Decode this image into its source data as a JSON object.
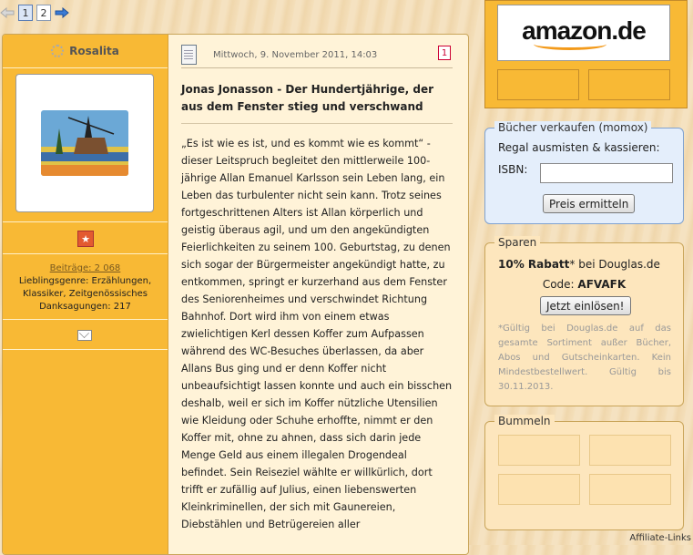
{
  "pager": {
    "pages": [
      "1",
      "2"
    ],
    "current": "1"
  },
  "author": {
    "name": "Rosalita",
    "posts_label": "Beiträge: 2 068",
    "genres": "Lieblingsgenre: Erzählungen, Klassiker, Zeitgenössisches",
    "thanks": "Danksagungen: 217"
  },
  "post": {
    "date": "Mittwoch, 9. November 2011, 14:03",
    "number": "1",
    "title": "Jonas Jonasson - Der Hundertjährige, der aus dem Fenster stieg und verschwand",
    "body": "„Es ist wie es ist, und es kommt wie es kommt“ - dieser Leitspruch begleitet den mittlerweile 100-jährige Allan Emanuel Karlsson sein Leben lang, ein Leben das turbulenter nicht sein kann. Trotz seines fortgeschrittenen Alters ist Allan körperlich und geistig überaus agil, und um den angekündigten Feierlichkeiten zu seinem 100. Geburtstag, zu denen sich sogar der Bürgermeister angekündigt hatte, zu entkommen, springt er kurzerhand aus dem Fenster des Seniorenheimes und verschwindet Richtung Bahnhof. Dort wird ihm von einem etwas zwielichtigen Kerl dessen Koffer zum Aufpassen während des WC-Besuches überlassen, da aber Allans Bus ging und er denn Koffer nicht unbeaufsichtigt lassen konnte und auch ein bisschen deshalb, weil er sich im Koffer nützliche Utensilien wie Kleidung oder Schuhe erhoffte, nimmt er den Koffer mit, ohne zu ahnen, dass sich darin jede Menge Geld aus einem illegalen Drogendeal befindet. Sein Reiseziel wählte er willkürlich, dort trifft er zufällig auf Julius, einen liebenswerten Kleinkriminellen, der sich mit Gaunereien, Diebstählen und Betrügereien aller"
  },
  "amazon": {
    "logo_text": "amazon.de"
  },
  "momox": {
    "legend": "Bücher verkaufen (momox)",
    "text": "Regal ausmisten & kassieren:",
    "isbn_label": "ISBN:",
    "button": "Preis ermitteln"
  },
  "sparen": {
    "legend": "Sparen",
    "discount": "10% Rabatt",
    "discount_suffix": "* bei Douglas.de",
    "code_label": "Code: ",
    "code": "AFVAFK",
    "button": "Jetzt einlösen!",
    "note": "*Gültig bei Douglas.de auf das gesamte Sortiment außer Bücher, Abos und Gutscheinkarten. Kein Mindestbestellwert. Gültig bis 30.11.2013."
  },
  "bummeln": {
    "legend": "Bummeln"
  },
  "affiliate": "Affiliate-Links",
  "colors": {
    "sidebar": "#f8b935",
    "post_bg": "#fff3d8",
    "momox_bg": "#e4eefb",
    "sparen_bg": "#fde6bd"
  },
  "icons": [
    "arrow-left-icon",
    "arrow-right-icon",
    "online-status-icon",
    "rank-star-icon",
    "mail-icon",
    "document-icon"
  ]
}
